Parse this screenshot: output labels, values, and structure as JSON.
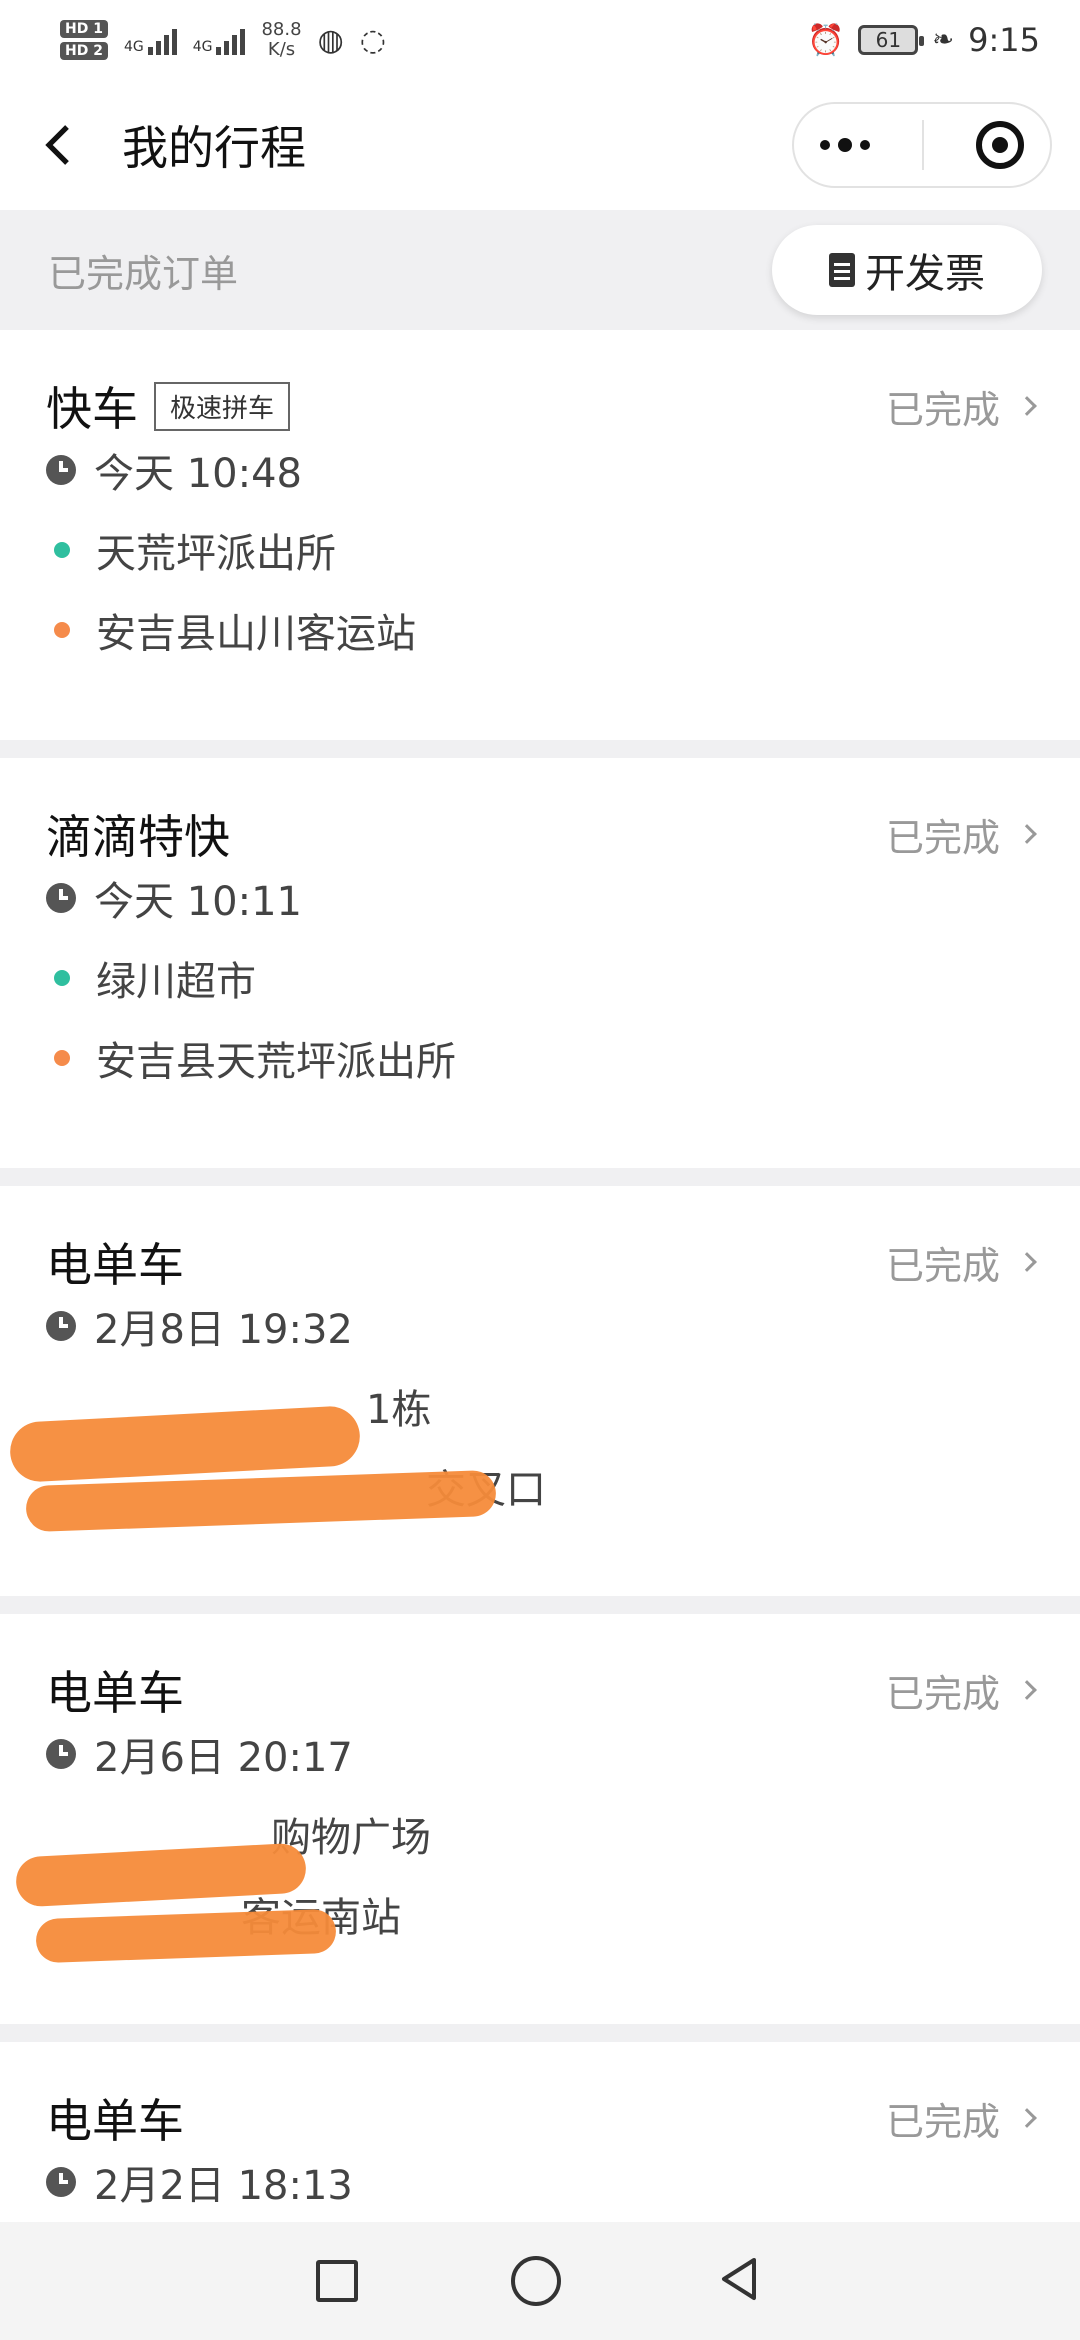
{
  "status_bar": {
    "sim1": "HD 1",
    "sim2": "HD 2",
    "network_type_1": "4G",
    "network_type_2": "4G",
    "speed": "88.8",
    "speed_unit": "K/s",
    "battery": "61",
    "time": "9:15"
  },
  "navbar": {
    "title": "我的行程"
  },
  "subheader": {
    "label": "已完成订单",
    "invoice_label": "开发票"
  },
  "orders": [
    {
      "title": "快车",
      "tag": "极速拼车",
      "status": "已完成",
      "time": "今天 10:48",
      "start": "天荒坪派出所",
      "end": "安吉县山川客运站"
    },
    {
      "title": "滴滴特快",
      "tag": "",
      "status": "已完成",
      "time": "今天 10:11",
      "start": "绿川超市",
      "end": "安吉县天荒坪派出所"
    },
    {
      "title": "电单车",
      "tag": "",
      "status": "已完成",
      "time": "2月8日 19:32",
      "start": "1栋",
      "end": "交叉口"
    },
    {
      "title": "电单车",
      "tag": "",
      "status": "已完成",
      "time": "2月6日 20:17",
      "start": "购物广场",
      "end": "客运南站"
    },
    {
      "title": "电单车",
      "tag": "",
      "status": "已完成",
      "time": "2月2日 18:13",
      "start": "",
      "end": ""
    }
  ],
  "colors": {
    "start_dot": "#2fbf9f",
    "end_dot": "#f58b4b",
    "redaction": "#f58b3a"
  }
}
